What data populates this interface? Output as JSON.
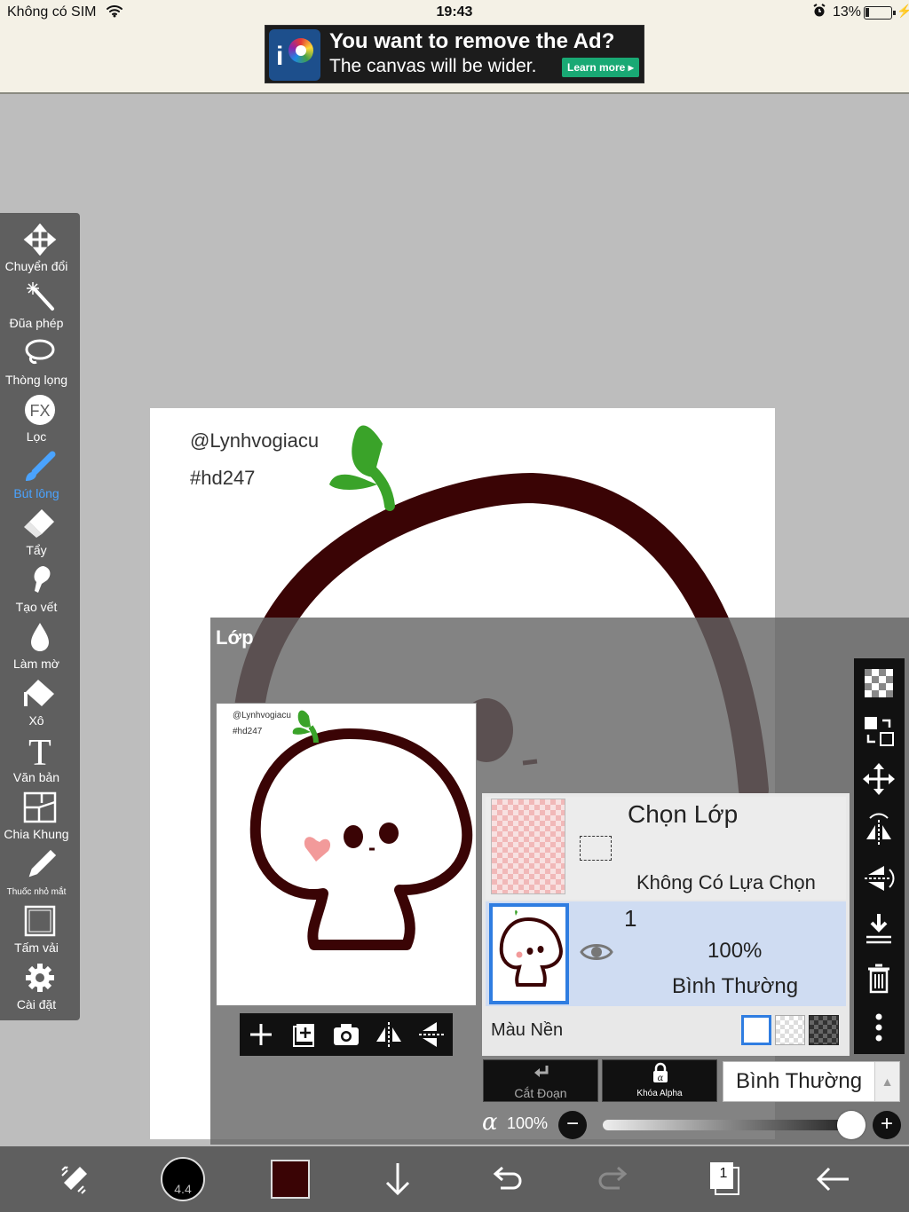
{
  "status_bar": {
    "carrier": "Không có SIM",
    "time": "19:43",
    "battery_percent": "13%",
    "battery_level": 0.13
  },
  "ad": {
    "title": "You want to remove the Ad?",
    "subtitle": "The canvas will be wider.",
    "button": "Learn more"
  },
  "canvas": {
    "handle": "@Lynhvogiacu",
    "tag": "#hd247",
    "stroke_color": "#3a0405",
    "sprout_color": "#3aa329"
  },
  "toolbar": {
    "tools": [
      {
        "label": "Chuyển đổi",
        "icon": "move-icon"
      },
      {
        "label": "Đũa phép",
        "icon": "magic-wand-icon"
      },
      {
        "label": "Thòng lọng",
        "icon": "lasso-icon"
      },
      {
        "label": "Lọc",
        "icon": "fx-filter-icon"
      },
      {
        "label": "Bút lông",
        "icon": "brush-icon",
        "active": true
      },
      {
        "label": "Tẩy",
        "icon": "eraser-icon"
      },
      {
        "label": "Tạo vết",
        "icon": "smudge-icon"
      },
      {
        "label": "Làm mờ",
        "icon": "blur-drop-icon"
      },
      {
        "label": "Xô",
        "icon": "bucket-icon"
      },
      {
        "label": "Văn bản",
        "icon": "text-icon"
      },
      {
        "label": "Chia Khung",
        "icon": "frame-divider-icon"
      },
      {
        "label": "Thuốc nhỏ mắt",
        "icon": "eyedropper-icon"
      },
      {
        "label": "Tấm vải",
        "icon": "canvas-icon"
      },
      {
        "label": "Cài đặt",
        "icon": "settings-gear-icon"
      }
    ],
    "active_color": "#4aa3ff"
  },
  "layer_panel": {
    "title": "Lớp",
    "preview": {
      "handle": "@Lynhvogiacu",
      "tag": "#hd247"
    },
    "selection_layer": {
      "title": "Chọn Lớp",
      "status": "Không Có Lựa Chọn"
    },
    "layers": [
      {
        "number": "1",
        "opacity": "100%",
        "blend": "Bình Thường",
        "visible": true
      }
    ],
    "background": {
      "label": "Màu Nền",
      "options": [
        "white",
        "checker",
        "dark-checker"
      ],
      "selected": "white"
    },
    "buttons": {
      "clipping": "Cắt Đoạn",
      "alpha_lock": "Khóa Alpha"
    },
    "blend_mode": "Bình Thường",
    "alpha": {
      "symbol": "α",
      "value": "100%",
      "level": 1.0
    }
  },
  "bottom_bar": {
    "brush_size": "4.4",
    "current_color": "#3a0405",
    "page_number": "1"
  }
}
